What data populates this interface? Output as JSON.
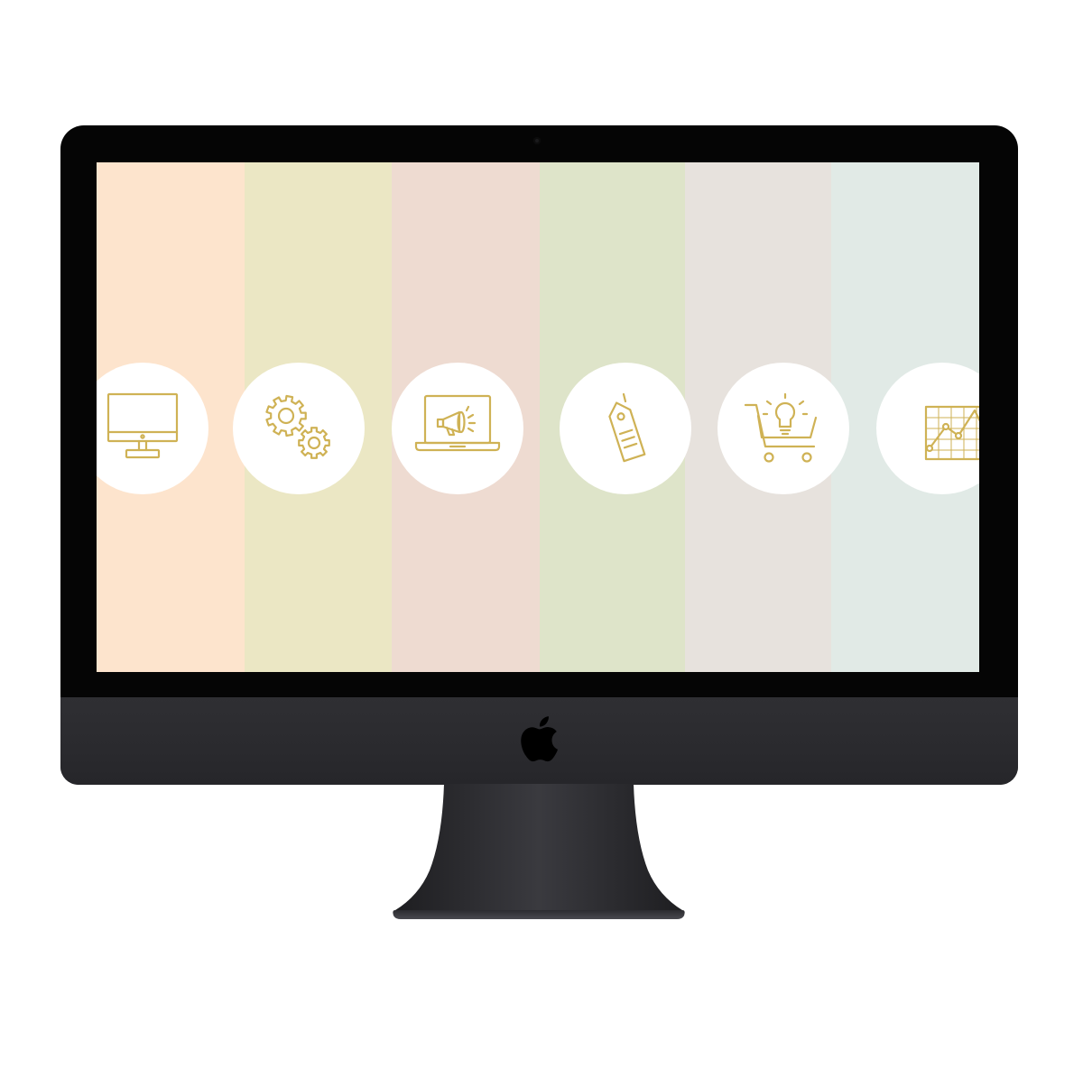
{
  "device": {
    "type": "desktop monitor",
    "logo_icon": "apple-logo-icon",
    "camera_icon": "webcam-icon"
  },
  "screen": {
    "stripes": [
      {
        "name": "peach",
        "color": "#fde4cd"
      },
      {
        "name": "olive",
        "color": "#ebe7c4"
      },
      {
        "name": "rose",
        "color": "#eedbd1"
      },
      {
        "name": "sage",
        "color": "#dee4c9"
      },
      {
        "name": "stone",
        "color": "#e7e2dd"
      },
      {
        "name": "mist",
        "color": "#e1eae6"
      }
    ],
    "icon_color": "#cfb255",
    "icons": [
      {
        "name": "desktop-computer-icon"
      },
      {
        "name": "gears-icon"
      },
      {
        "name": "laptop-megaphone-icon"
      },
      {
        "name": "price-tag-icon"
      },
      {
        "name": "shopping-cart-idea-icon"
      },
      {
        "name": "line-chart-icon"
      }
    ]
  }
}
